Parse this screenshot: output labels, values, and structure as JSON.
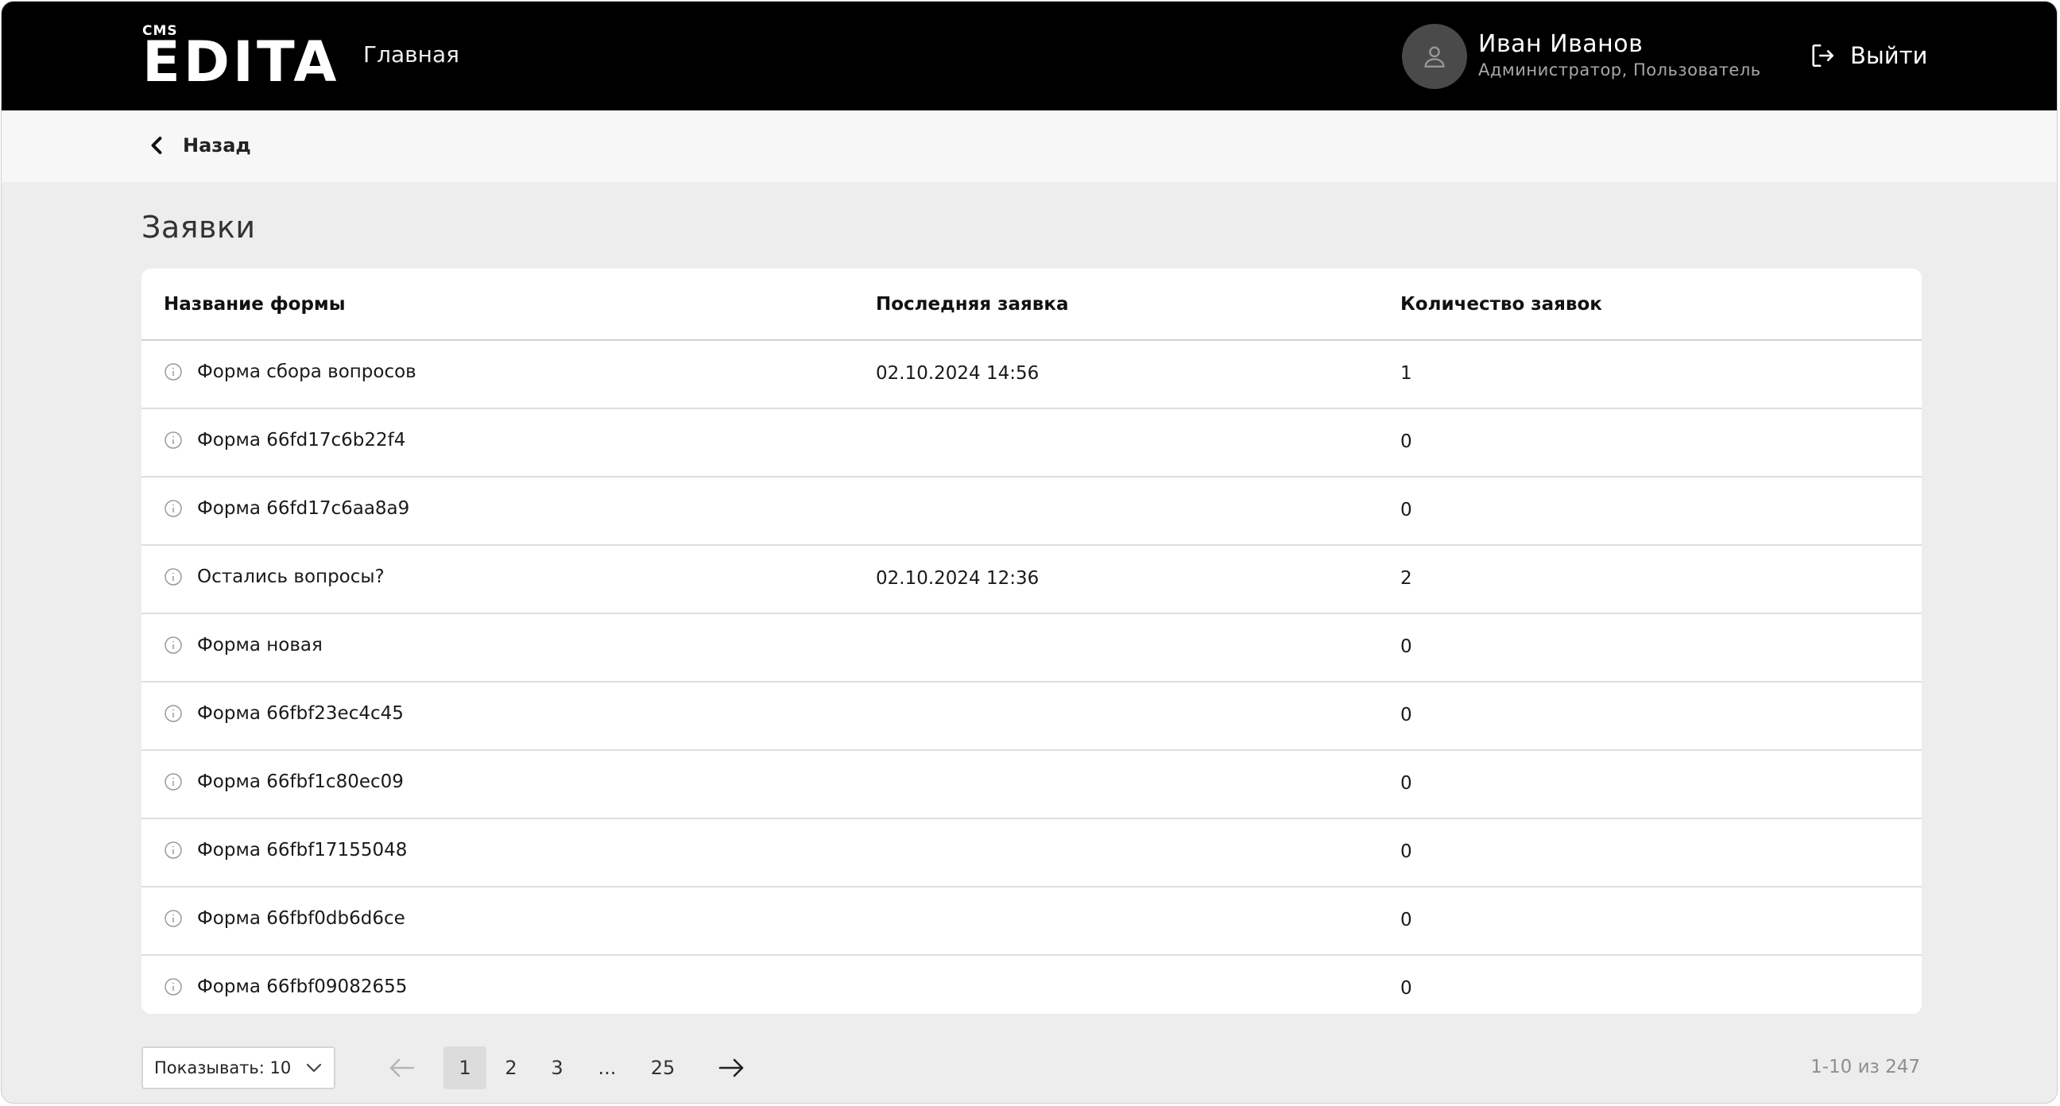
{
  "header": {
    "logo_small": "CMS",
    "logo_brand": "EDITA",
    "nav_home": "Главная",
    "user_name": "Иван Иванов",
    "user_roles": "Администратор, Пользователь",
    "logout_label": "Выйти"
  },
  "breadcrumb": {
    "back_label": "Назад"
  },
  "page_title": "Заявки",
  "table": {
    "columns": [
      "Название формы",
      "Последняя заявка",
      "Количество заявок"
    ],
    "rows": [
      {
        "name": "Форма сбора вопросов",
        "last": "02.10.2024 14:56",
        "count": "1"
      },
      {
        "name": "Форма 66fd17c6b22f4",
        "last": "",
        "count": "0"
      },
      {
        "name": "Форма 66fd17c6aa8a9",
        "last": "",
        "count": "0"
      },
      {
        "name": "Остались вопросы?",
        "last": "02.10.2024 12:36",
        "count": "2"
      },
      {
        "name": "Форма новая",
        "last": "",
        "count": "0"
      },
      {
        "name": "Форма 66fbf23ec4c45",
        "last": "",
        "count": "0"
      },
      {
        "name": "Форма 66fbf1c80ec09",
        "last": "",
        "count": "0"
      },
      {
        "name": "Форма 66fbf17155048",
        "last": "",
        "count": "0"
      },
      {
        "name": "Форма 66fbf0db6d6ce",
        "last": "",
        "count": "0"
      },
      {
        "name": "Форма 66fbf09082655",
        "last": "",
        "count": "0"
      }
    ]
  },
  "pagination": {
    "page_size_label": "Показывать: 10",
    "pages": [
      "1",
      "2",
      "3",
      "...",
      "25"
    ],
    "current": "1",
    "range_text": "1-10 из 247"
  },
  "icons": {
    "info": "info-circle-icon",
    "back": "chevron-left-icon",
    "logout": "logout-icon",
    "avatar": "user-icon",
    "prev": "arrow-left-icon",
    "next": "arrow-right-icon",
    "dropdown": "chevron-down-icon"
  },
  "colors": {
    "header_bg": "#000000",
    "page_bg": "#ededed",
    "card_bg": "#ffffff",
    "active_page_bg": "#dcdcdc"
  }
}
